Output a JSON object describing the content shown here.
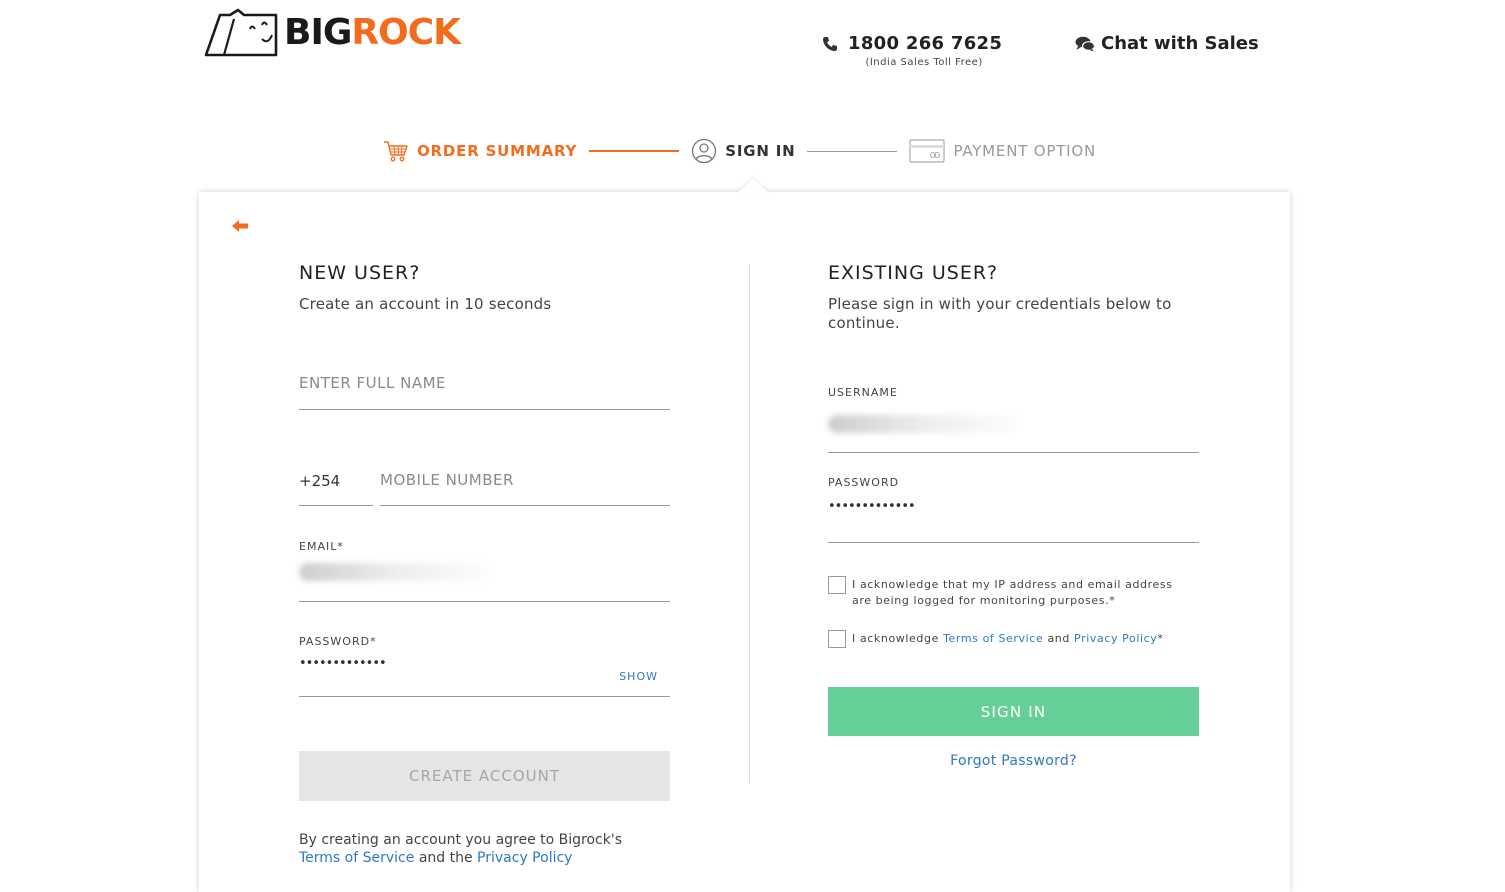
{
  "header": {
    "logo_big": "BIG",
    "logo_rock": "ROCK",
    "phone_number": "1800 266 7625",
    "phone_sub": "(India Sales Toll Free)",
    "chat_label": "Chat with Sales"
  },
  "stepper": {
    "steps": [
      {
        "label": "ORDER SUMMARY",
        "icon": "cart-icon",
        "state": "completed"
      },
      {
        "label": "SIGN IN",
        "icon": "user-icon",
        "state": "active"
      },
      {
        "label": "PAYMENT OPTION",
        "icon": "card-icon",
        "state": "pending"
      }
    ]
  },
  "new_user": {
    "title": "NEW USER?",
    "subtitle": "Create an account in 10 seconds",
    "full_name_placeholder": "ENTER FULL NAME",
    "country_code": "+254",
    "mobile_placeholder": "MOBILE NUMBER",
    "email_label": "EMAIL*",
    "password_label": "PASSWORD*",
    "password_value": "•••••••••••••",
    "show_label": "SHOW",
    "create_button": "CREATE ACCOUNT",
    "agree_prefix": "By creating an account you agree to Bigrock's",
    "terms_link": "Terms of Service",
    "agree_middle": "and the",
    "privacy_link": "Privacy Policy"
  },
  "existing_user": {
    "title": "EXISTING USER?",
    "subtitle": "Please sign in with your credentials below to continue.",
    "username_label": "USERNAME",
    "password_label": "PASSWORD",
    "password_value": "•••••••••••••",
    "ack_ip": "I acknowledge that my IP address and email address are being logged for monitoring purposes.*",
    "ack_terms_prefix": "I acknowledge",
    "ack_terms_link": "Terms of Service",
    "ack_terms_and": "and",
    "ack_privacy_link": "Privacy Policy",
    "ack_terms_suffix": "*",
    "signin_button": "SIGN IN",
    "forgot_link": "Forgot Password?"
  },
  "colors": {
    "brand_orange": "#f26c1e",
    "signin_green": "#66cf98",
    "link_blue": "#2e78c5"
  }
}
